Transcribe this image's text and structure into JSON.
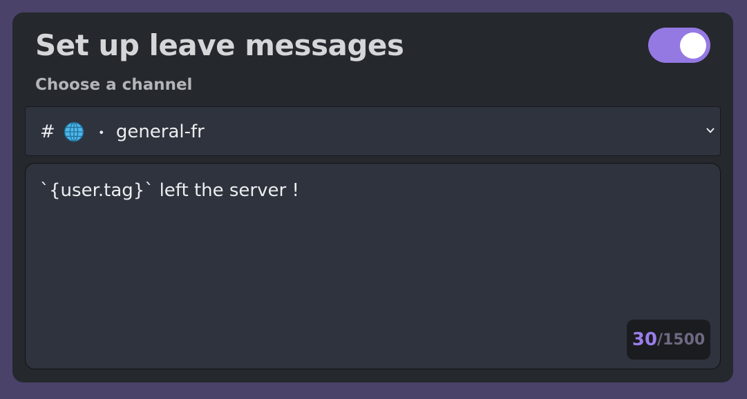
{
  "header": {
    "title": "Set up leave messages",
    "enabled": true
  },
  "channel": {
    "label": "Choose a channel",
    "selected": {
      "prefix": "#",
      "icon": "globe-icon",
      "separator": "・",
      "name": "general-fr"
    }
  },
  "message": {
    "value": "`{user.tag}` left the server !",
    "counter_current": "30",
    "counter_separator": "/",
    "counter_max": "1500"
  },
  "colors": {
    "background": "#4a4269",
    "card": "#25282d",
    "accent": "#9579e3",
    "field": "#2e333d"
  }
}
